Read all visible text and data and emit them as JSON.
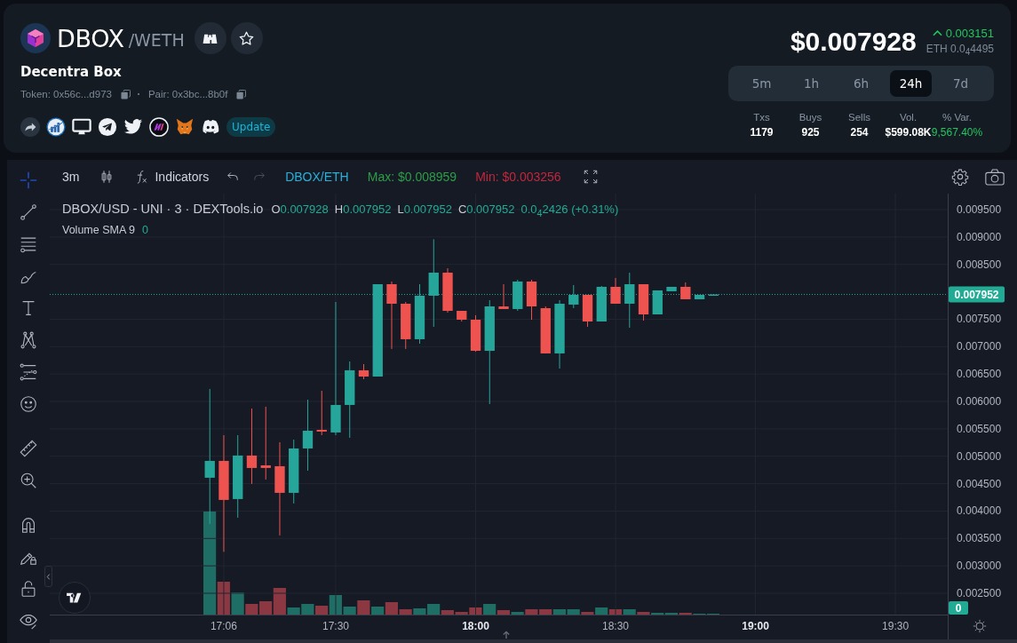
{
  "header": {
    "token": {
      "symbol": "DBOX",
      "quote": "/WETH",
      "name": "Decentra Box"
    },
    "addresses": [
      "Token: 0x56c...d973",
      "Pair: 0x3bc...8b0f"
    ],
    "update_button": "Update",
    "price": "$0.007928",
    "change": {
      "up": true,
      "value": "0.003151"
    },
    "eth_price": "ETH 0.0$_{4}$4495",
    "timeframes": [
      {
        "label": "5m",
        "selected": false
      },
      {
        "label": "1h",
        "selected": false
      },
      {
        "label": "6h",
        "selected": false
      },
      {
        "label": "24h",
        "selected": true
      },
      {
        "label": "7d",
        "selected": false
      }
    ],
    "stats": [
      {
        "label": "Txs",
        "value": "1179",
        "kind": "plain"
      },
      {
        "label": "Buys",
        "value": "925",
        "kind": "plain"
      },
      {
        "label": "Sells",
        "value": "254",
        "kind": "plain"
      },
      {
        "label": "Vol.",
        "value": "$599.08K",
        "kind": "plain"
      },
      {
        "label": "% Var.",
        "value": "9,567.40%",
        "kind": "positive"
      }
    ]
  },
  "chart": {
    "tool_groups": [
      {
        "tools": [
          {
            "kind": "crosshair",
            "selected": true
          },
          {
            "kind": "trend-line",
            "selected": false
          },
          {
            "kind": "horizontal-lines",
            "selected": false
          },
          {
            "kind": "brush",
            "selected": false
          },
          {
            "kind": "text",
            "selected": false
          },
          {
            "kind": "pattern",
            "selected": false
          },
          {
            "kind": "forecast",
            "selected": false
          },
          {
            "kind": "emoji",
            "selected": false
          }
        ]
      },
      {
        "tools": [
          {
            "kind": "ruler",
            "selected": false
          },
          {
            "kind": "zoom-in",
            "selected": false
          }
        ]
      },
      {
        "tools": [
          {
            "kind": "magnet",
            "selected": false
          },
          {
            "kind": "lock-drawings",
            "selected": false
          },
          {
            "kind": "unlock",
            "selected": false
          },
          {
            "kind": "visibility",
            "selected": false
          }
        ]
      }
    ],
    "toolbar": {
      "interval": "3m",
      "indicators": "Indicators",
      "history": [
        {
          "kind": "undo",
          "disabled": false
        },
        {
          "kind": "redo",
          "disabled": true
        }
      ],
      "pair_toggle": "DBOX/ETH",
      "max": "Max: $0.008959",
      "min": "Min: $0.003256"
    },
    "legend": {
      "title": "DBOX/USD - UNI · 3 · DEXTools.io",
      "ohlc": [
        {
          "label": "O",
          "value": "0.007928"
        },
        {
          "label": "H",
          "value": "0.007952"
        },
        {
          "label": "L",
          "value": "0.007952"
        },
        {
          "label": "C",
          "value": "0.007952"
        }
      ],
      "change": "0.0$_{4}$2426 (+0.31%)"
    },
    "volume_legend": {
      "label": "Volume SMA 9",
      "value": "0"
    },
    "volume_axis_label": "0",
    "chart_data": [
      {
        "type": "candlestick",
        "x": [
          17.05,
          17.1,
          17.15,
          17.2,
          17.25,
          17.3,
          17.35,
          17.4,
          17.45,
          17.5,
          17.55,
          17.6,
          17.65,
          17.7,
          17.75,
          17.8,
          17.85,
          17.9,
          17.95,
          18,
          18.05,
          18.1,
          18.15,
          18.2,
          18.25,
          18.3,
          18.35,
          18.4,
          18.45,
          18.5,
          18.55,
          18.6,
          18.65,
          18.7,
          18.75,
          18.8,
          18.85
        ],
        "ohlc": [
          [
            0.004608,
            0.006228,
            0.003765,
            0.004915
          ],
          [
            0.004915,
            0.005385,
            0.003256,
            0.004203
          ],
          [
            0.004219,
            0.005385,
            0.003879,
            0.005013
          ],
          [
            0.005013,
            0.005871,
            0.004494,
            0.004786
          ],
          [
            0.004834,
            0.005904,
            0.004575,
            0.004786
          ],
          [
            0.004818,
            0.005256,
            0.003555,
            0.004332
          ],
          [
            0.004332,
            0.005304,
            0.004138,
            0.005142
          ],
          [
            0.005142,
            0.006033,
            0.004737,
            0.005466
          ],
          [
            0.005482,
            0.006195,
            0.005385,
            0.00545
          ],
          [
            0.005434,
            0.007815,
            0.005385,
            0.005936
          ],
          [
            0.005936,
            0.00673,
            0.005337,
            0.006568
          ],
          [
            0.006568,
            0.006681,
            0.006406,
            0.006454
          ],
          [
            0.006454,
            0.008139,
            0.006454,
            0.008139
          ],
          [
            0.008139,
            0.008188,
            0.006957,
            0.007783
          ],
          [
            0.007783,
            0.007815,
            0.006957,
            0.007135
          ],
          [
            0.007135,
            0.008139,
            0.007054,
            0.007929
          ],
          [
            0.007929,
            0.008959,
            0.007362,
            0.00835
          ],
          [
            0.00835,
            0.008431,
            0.00762,
            0.007653
          ],
          [
            0.007653,
            0.007653,
            0.007459,
            0.007491
          ],
          [
            0.007491,
            0.007572,
            0.006908,
            0.006924
          ],
          [
            0.006924,
            0.007848,
            0.005952,
            0.007734
          ],
          [
            0.007734,
            0.008139,
            0.007686,
            0.007686
          ],
          [
            0.007686,
            0.00822,
            0.007653,
            0.008188
          ],
          [
            0.008188,
            0.00822,
            0.007491,
            0.007734
          ],
          [
            0.007702,
            0.007734,
            0.006876,
            0.006876
          ],
          [
            0.006876,
            0.007848,
            0.0066,
            0.007783
          ],
          [
            0.007767,
            0.008123,
            0.007702,
            0.007945
          ],
          [
            0.007945,
            0.007945,
            0.007362,
            0.007459
          ],
          [
            0.007459,
            0.008107,
            0.007459,
            0.008091
          ],
          [
            0.008091,
            0.008253,
            0.007783,
            0.007783
          ],
          [
            0.007783,
            0.00835,
            0.007346,
            0.008139
          ],
          [
            0.008139,
            0.008139,
            0.007475,
            0.007588
          ],
          [
            0.007588,
            0.008026,
            0.007588,
            0.008026
          ],
          [
            0.00801,
            0.008091,
            0.00801,
            0.008091
          ],
          [
            0.008091,
            0.008172,
            0.007864,
            0.007864
          ],
          [
            0.007864,
            0.007945,
            0.007864,
            0.007945
          ],
          [
            0.007928,
            0.007961,
            0.007928,
            0.007952
          ]
        ],
        "xlim": [
          16.478,
          19.687
        ],
        "ylim": [
          0.002111,
          0.009792
        ],
        "xticks": [
          {
            "value": 17.1,
            "label": "17:06"
          },
          {
            "value": 17.5,
            "label": "17:30"
          },
          {
            "value": 18,
            "label": "18:00"
          },
          {
            "value": 18.5,
            "label": "18:30"
          },
          {
            "value": 19,
            "label": "19:00"
          },
          {
            "value": 19.5,
            "label": "19:30"
          }
        ],
        "yticks": [
          {
            "value": 0.0095,
            "label": "0.009500"
          },
          {
            "value": 0.009,
            "label": "0.009000"
          },
          {
            "value": 0.0085,
            "label": "0.008500"
          },
          {
            "value": 0.0075,
            "label": "0.007500"
          },
          {
            "value": 0.007,
            "label": "0.007000"
          },
          {
            "value": 0.0065,
            "label": "0.006500"
          },
          {
            "value": 0.006,
            "label": "0.006000"
          },
          {
            "value": 0.0055,
            "label": "0.005500"
          },
          {
            "value": 0.005,
            "label": "0.005000"
          },
          {
            "value": 0.0045,
            "label": "0.004500"
          },
          {
            "value": 0.004,
            "label": "0.004000"
          },
          {
            "value": 0.0035,
            "label": "0.003500"
          },
          {
            "value": 0.003,
            "label": "0.003000"
          },
          {
            "value": 0.0025,
            "label": "0.002500"
          }
        ],
        "ref_lines": [
          {
            "axis": "y",
            "value": 0.007952,
            "label": "0.007952",
            "line_style": "dotted"
          }
        ],
        "grid": true
      }
    ]
  }
}
